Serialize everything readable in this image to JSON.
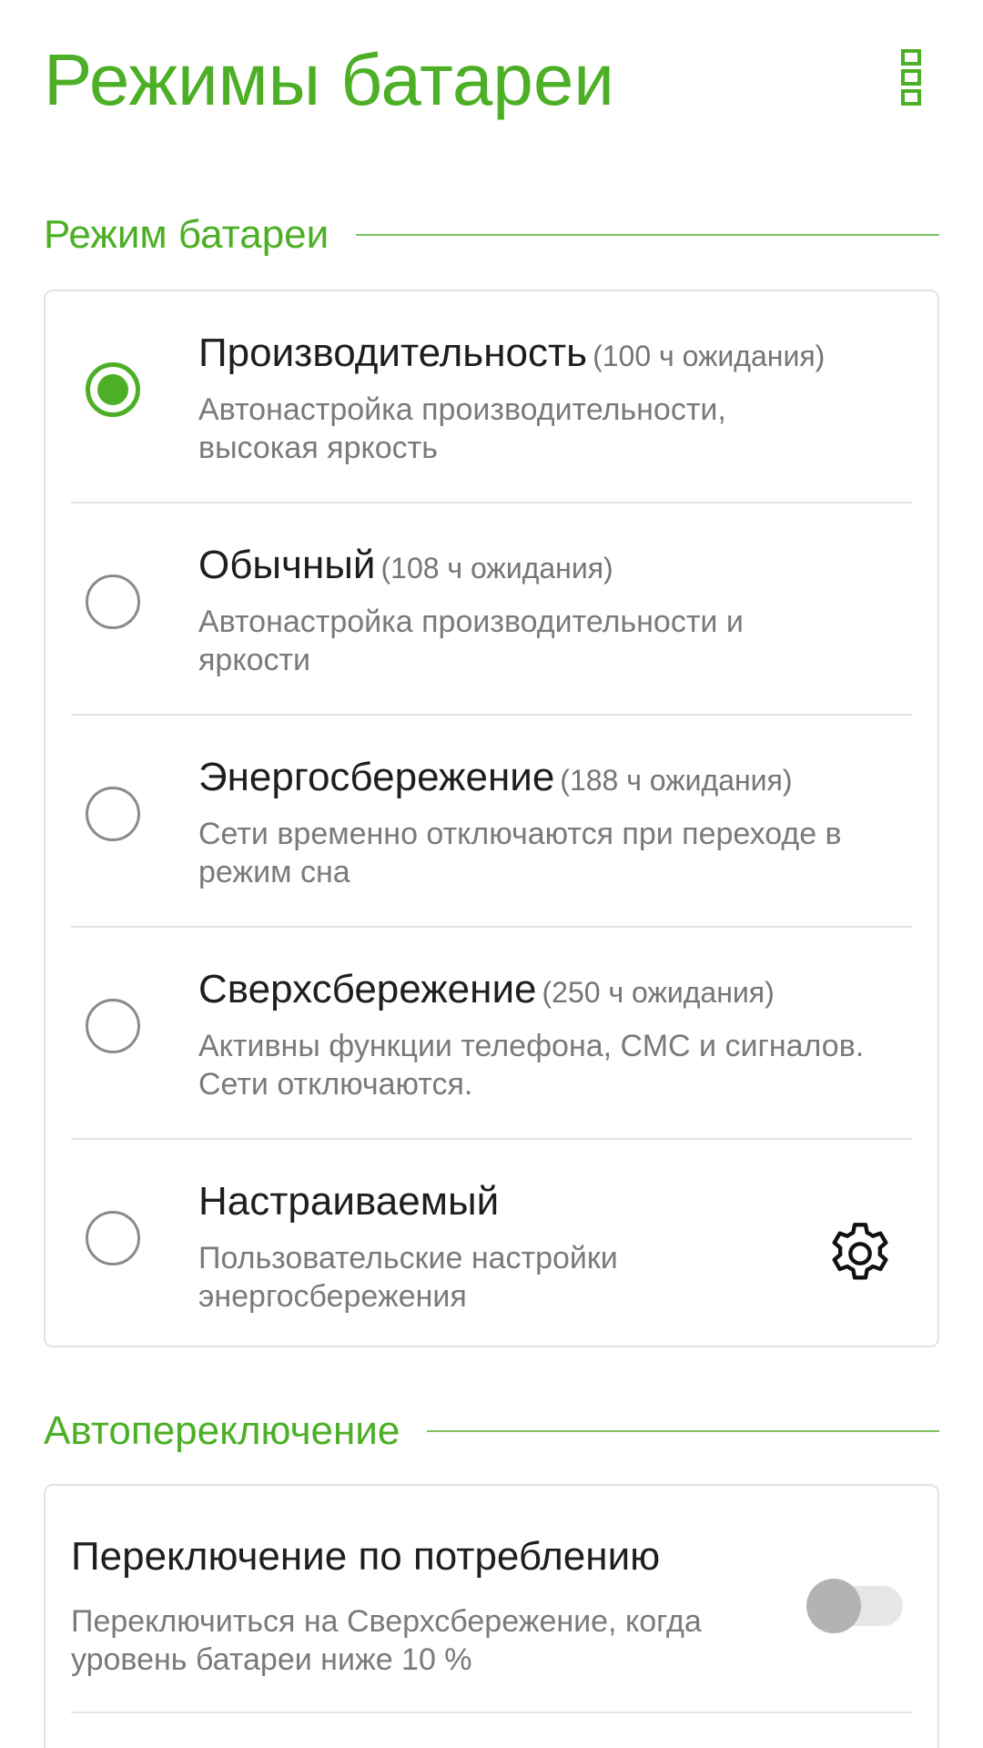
{
  "header": {
    "title": "Режимы батареи",
    "menu_icon": "more-vert-icon"
  },
  "battery_section": {
    "label": "Режим батареи",
    "modes": [
      {
        "title": "Производительность",
        "standby": "(100 ч ожидания)",
        "description": "Автонастройка производительности, высокая яркость",
        "selected": true
      },
      {
        "title": "Обычный",
        "standby": "(108 ч ожидания)",
        "description": "Автонастройка производительности и яркости",
        "selected": false
      },
      {
        "title": "Энергосбережение",
        "standby": "(188 ч ожидания)",
        "description": "Сети временно отключаются при переходе в режим сна",
        "selected": false
      },
      {
        "title": "Сверхсбережение",
        "standby": "(250 ч ожидания)",
        "description": "Активны функции телефона, СМС и сигналов. Сети отключаются.",
        "selected": false
      },
      {
        "title": "Настраиваемый",
        "standby": "",
        "description": "Пользовательские настройки энергосбережения",
        "selected": false,
        "settings_icon": "gear-icon"
      }
    ]
  },
  "auto_section": {
    "label": "Автопереключение",
    "items": [
      {
        "title": "Переключение по потреблению",
        "description": "Переключиться на Сверхсбережение, когда уровень батареи ниже 10 %",
        "enabled": false
      }
    ]
  },
  "colors": {
    "accent": "#4caf25",
    "text_primary": "#1e1e1e",
    "text_secondary": "#7a7a7a"
  }
}
